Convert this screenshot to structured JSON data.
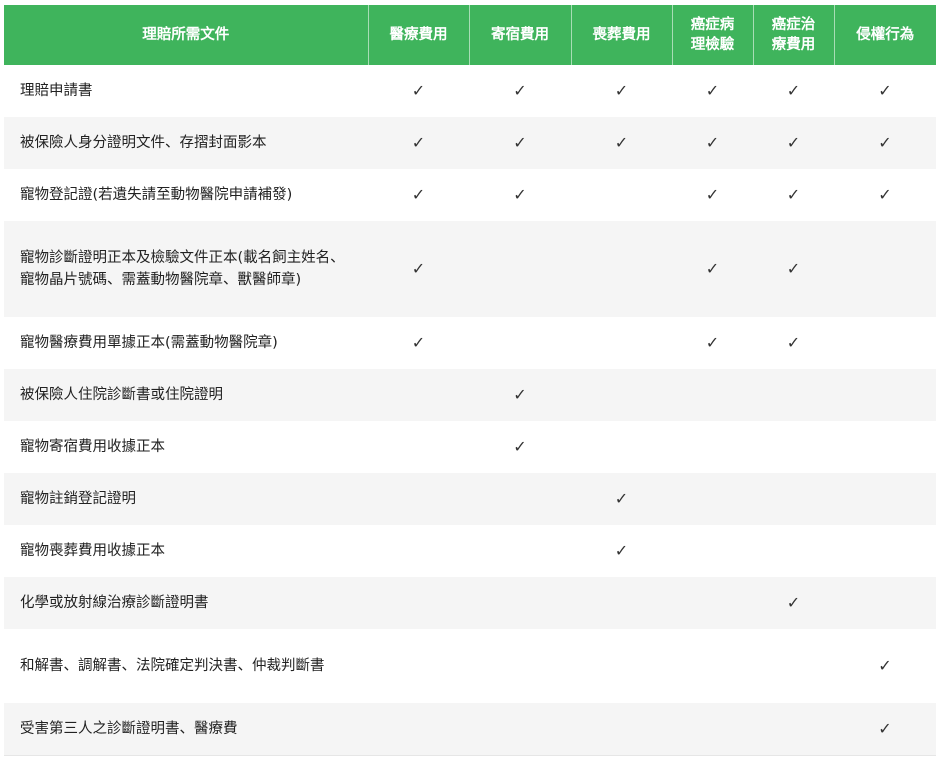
{
  "table": {
    "headers": [
      "理賠所需文件",
      "醫療費用",
      "寄宿費用",
      "喪葬費用",
      "癌症病\n理檢驗",
      "癌症治\n療費用",
      "侵權行為"
    ],
    "check_glyph": "✓",
    "header_color": "#3fb45c",
    "rows": [
      {
        "label": "理賠申請書",
        "marks": [
          true,
          true,
          true,
          true,
          true,
          true
        ]
      },
      {
        "label": "被保險人身分證明文件、存摺封面影本",
        "marks": [
          true,
          true,
          true,
          true,
          true,
          true
        ]
      },
      {
        "label": "寵物登記證(若遺失請至動物醫院申請補發)",
        "marks": [
          true,
          true,
          false,
          true,
          true,
          true
        ]
      },
      {
        "label": "寵物診斷證明正本及檢驗文件正本(載名飼主姓名、寵物晶片號碼、需蓋動物醫院章、獸醫師章)",
        "marks": [
          true,
          false,
          false,
          true,
          true,
          false
        ]
      },
      {
        "label": "寵物醫療費用單據正本(需蓋動物醫院章)",
        "marks": [
          true,
          false,
          false,
          true,
          true,
          false
        ]
      },
      {
        "label": "被保險人住院診斷書或住院證明",
        "marks": [
          false,
          true,
          false,
          false,
          false,
          false
        ]
      },
      {
        "label": "寵物寄宿費用收據正本",
        "marks": [
          false,
          true,
          false,
          false,
          false,
          false
        ]
      },
      {
        "label": "寵物註銷登記證明",
        "marks": [
          false,
          false,
          true,
          false,
          false,
          false
        ]
      },
      {
        "label": "寵物喪葬費用收據正本",
        "marks": [
          false,
          false,
          true,
          false,
          false,
          false
        ]
      },
      {
        "label": "化學或放射線治療診斷證明書",
        "marks": [
          false,
          false,
          false,
          false,
          true,
          false
        ]
      },
      {
        "label": "和解書、調解書、法院確定判決書、仲裁判斷書",
        "marks": [
          false,
          false,
          false,
          false,
          false,
          true
        ]
      },
      {
        "label": "受害第三人之診斷證明書、醫療費",
        "marks": [
          false,
          false,
          false,
          false,
          false,
          true
        ]
      }
    ]
  }
}
